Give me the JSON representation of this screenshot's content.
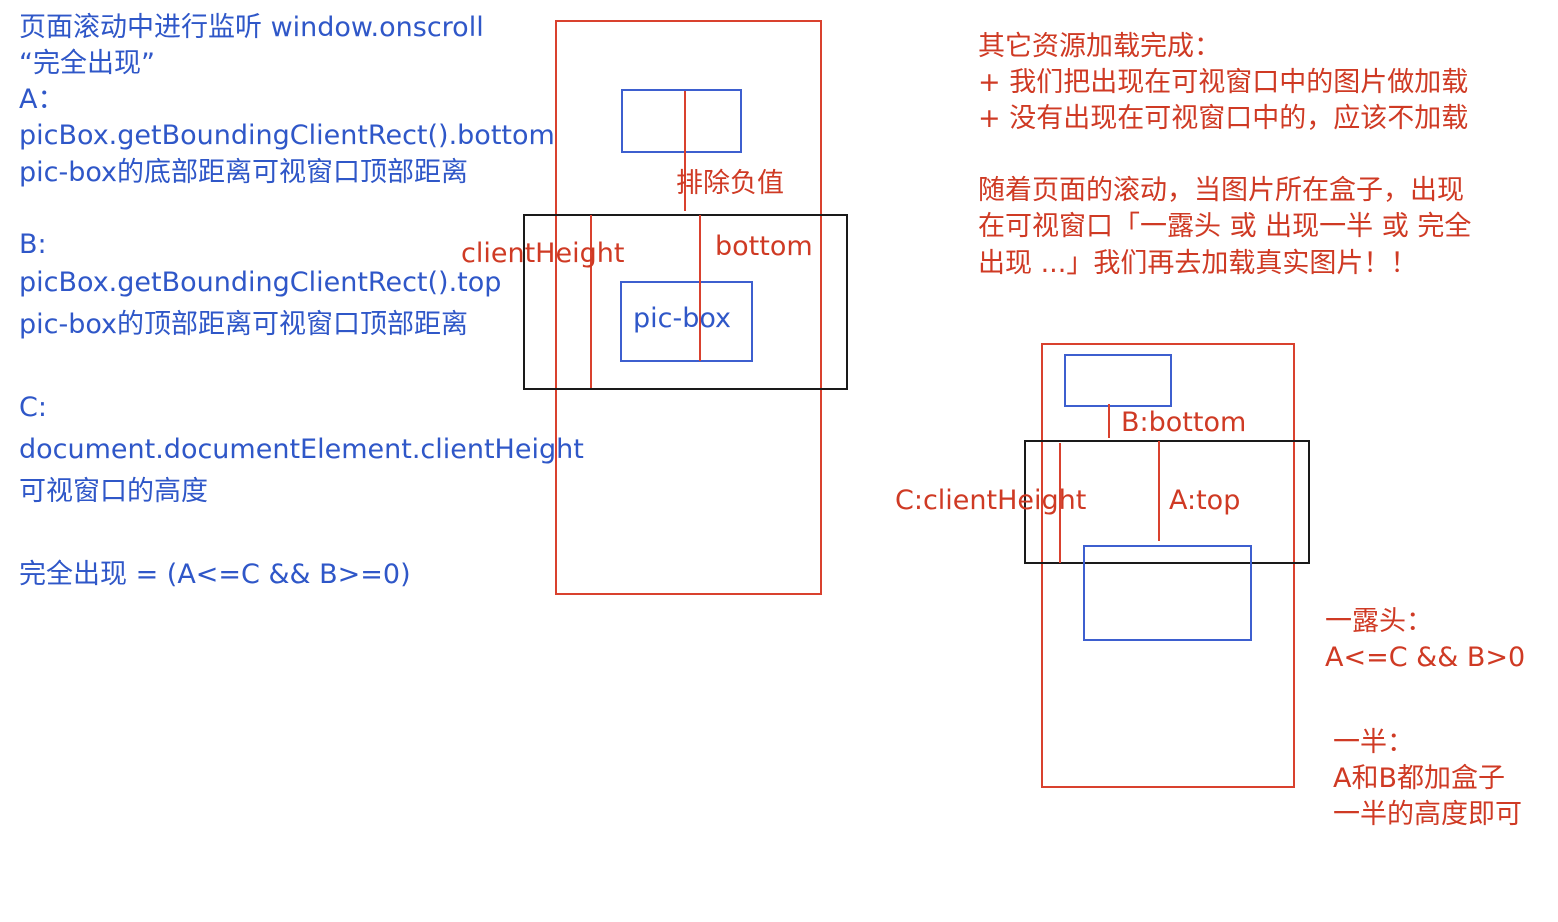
{
  "left_notes": {
    "line1": "页面滚动中进行监听 window.onscroll",
    "line2": "“完全出现”",
    "a_label": "A：",
    "a_expr": "picBox.getBoundingClientRect().bottom",
    "a_desc": "pic-box的底部距离可视窗口顶部距离",
    "b_label": "B:",
    "b_expr": "picBox.getBoundingClientRect().top",
    "b_desc": "pic-box的顶部距离可视窗口顶部距离",
    "c_label": "C:",
    "c_expr": "document.documentElement.clientHeight",
    "c_desc": "可视窗口的高度",
    "formula": "完全出现 = (A<=C && B>=0)"
  },
  "diagram1": {
    "exclude_label": "排除负值",
    "client_height_label": "clientHeight",
    "bottom_label": "bottom",
    "pic_box_label": "pic-box"
  },
  "right_notes": {
    "line1": "其它资源加载完成：",
    "line2": "+ 我们把出现在可视窗口中的图片做加载",
    "line3": "+ 没有出现在可视窗口中的，应该不加载",
    "line4": "随着页面的滚动，当图片所在盒子，出现",
    "line5": "在可视窗口「一露头 或 出现一半 或 完全",
    "line6": "出现 ...」我们再去加载真实图片！！"
  },
  "diagram2": {
    "b_bottom_label": "B:bottom",
    "c_client_height_label": "C:clientHeight",
    "a_top_label": "A:top"
  },
  "conditions": {
    "peek_title": "一露头：",
    "peek_expr": "A<=C && B>0",
    "half_title": "一半：",
    "half_line1": "A和B都加盒子",
    "half_line2": "一半的高度即可"
  },
  "colors": {
    "text_blue": "#2f57c8",
    "text_red": "#cf3a24",
    "line_red": "#d9412e",
    "line_blue": "#3d5fcf",
    "line_black": "#1a1a1a"
  }
}
